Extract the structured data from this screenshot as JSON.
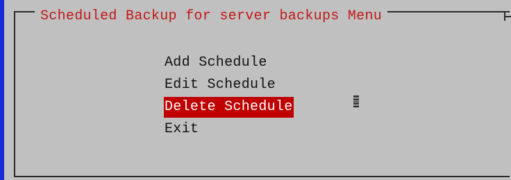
{
  "title": "Scheduled Backup for server backups Menu",
  "menu": {
    "items": [
      {
        "label": "Add Schedule",
        "selected": false
      },
      {
        "label": "Edit Schedule",
        "selected": false
      },
      {
        "label": "Delete Schedule",
        "selected": true
      },
      {
        "label": "Exit",
        "selected": false
      }
    ]
  },
  "colors": {
    "background": "#c0c0c0",
    "title_text": "#c01818",
    "selection_bg": "#c00000",
    "selection_text": "#ffffff",
    "left_rail": "#1a2bd6"
  },
  "icons": {
    "cursor": "text-cursor-icon"
  }
}
